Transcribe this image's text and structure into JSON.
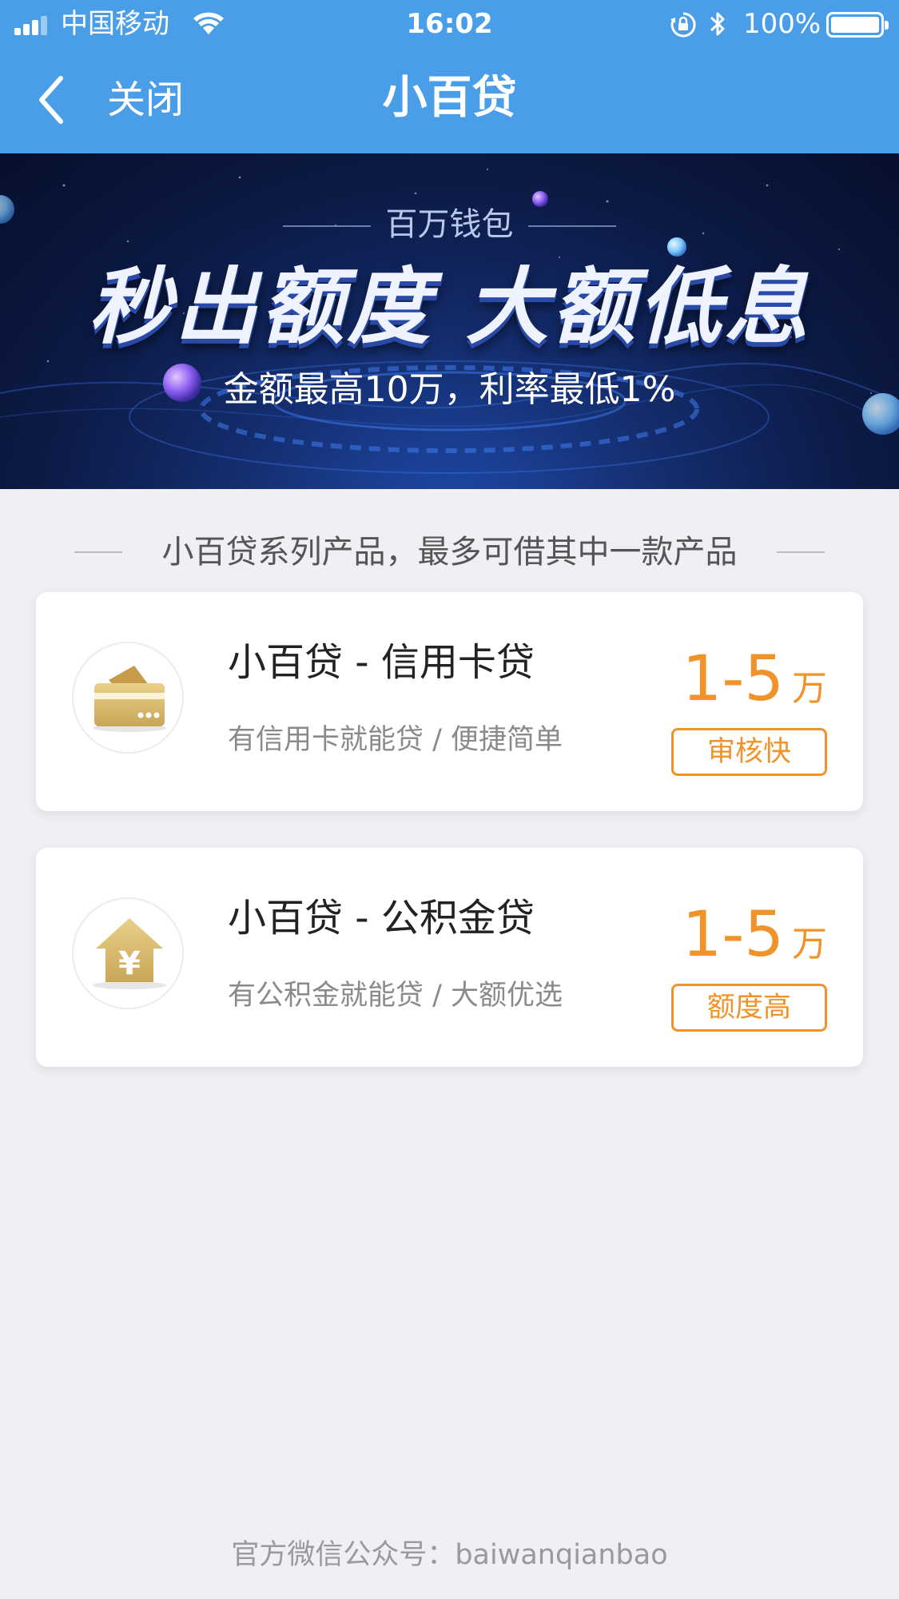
{
  "status_bar": {
    "carrier": "中国移动",
    "time": "16:02",
    "battery_percent": "100%",
    "icons": [
      "signal-icon",
      "wifi-icon",
      "rotation-lock-icon",
      "bluetooth-icon",
      "battery-icon"
    ]
  },
  "nav": {
    "back_icon": "chevron-left-icon",
    "close_label": "关闭",
    "title": "小百贷"
  },
  "banner": {
    "subtitle": "百万钱包",
    "headline": "秒出额度 大额低息",
    "description": "金额最高10万，利率最低1%"
  },
  "section": {
    "title": "小百贷系列产品，最多可借其中一款产品"
  },
  "products": [
    {
      "name": "小百贷 - 信用卡贷",
      "description": "有信用卡就能贷 / 便捷简单",
      "amount": "1-5",
      "unit": "万",
      "tag": "审核快",
      "icon": "credit-card-icon"
    },
    {
      "name": "小百贷 - 公积金贷",
      "description": "有公积金就能贷 / 大额优选",
      "amount": "1-5",
      "unit": "万",
      "tag": "额度高",
      "icon": "house-yuan-icon"
    }
  ],
  "footer": {
    "text": "官方微信公众号：baiwanqianbao"
  },
  "colors": {
    "nav_blue": "#4a9ee8",
    "accent_orange": "#f0932b",
    "background": "#efeff4"
  }
}
